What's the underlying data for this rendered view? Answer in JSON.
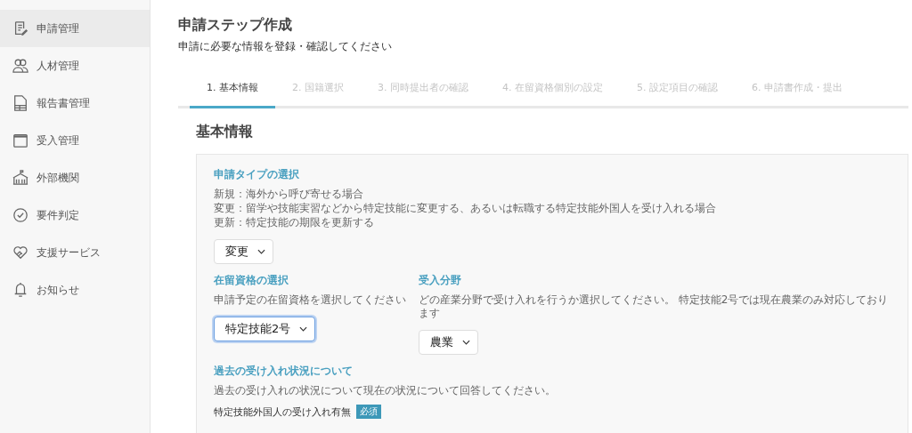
{
  "sidebar": {
    "items": [
      {
        "label": "申請管理",
        "selected": true
      },
      {
        "label": "人材管理",
        "selected": false
      },
      {
        "label": "報告書管理",
        "selected": false
      },
      {
        "label": "受入管理",
        "selected": false
      },
      {
        "label": "外部機関",
        "selected": false
      },
      {
        "label": "要件判定",
        "selected": false
      },
      {
        "label": "支援サービス",
        "selected": false
      },
      {
        "label": "お知らせ",
        "selected": false
      }
    ]
  },
  "page": {
    "title": "申請ステップ作成",
    "subtitle": "申請に必要な情報を登録・確認してください"
  },
  "steps": [
    {
      "label": "1. 基本情報",
      "selected": true
    },
    {
      "label": "2. 国籍選択",
      "selected": false
    },
    {
      "label": "3. 同時提出者の確認",
      "selected": false
    },
    {
      "label": "4. 在留資格個別の設定",
      "selected": false
    },
    {
      "label": "5. 設定項目の確認",
      "selected": false
    },
    {
      "label": "6. 申請書作成・提出",
      "selected": false
    }
  ],
  "section_title": "基本情報",
  "form": {
    "application_type": {
      "title": "申請タイプの選択",
      "notes": [
        "新規：海外から呼び寄せる場合",
        "変更：留学や技能実習などから特定技能に変更する、あるいは転職する特定技能外国人を受け入れる場合",
        "更新：特定技能の期限を更新する"
      ],
      "value": "変更",
      "focused": false
    },
    "status": {
      "title": "在留資格の選択",
      "note": "申請予定の在留資格を選択してください",
      "value": "特定技能2号",
      "focused": true
    },
    "field": {
      "title": "受入分野",
      "note": "どの産業分野で受け入れを行うか選択してください。 特定技能2号では現在農業のみ対応しております",
      "value": "農業",
      "focused": false
    },
    "history": {
      "title": "過去の受け入れ状況について",
      "note": "過去の受け入れの状況について現在の状況について回答してください。",
      "question": "特定技能外国人の受け入れ有無",
      "badge": "必須"
    }
  }
}
